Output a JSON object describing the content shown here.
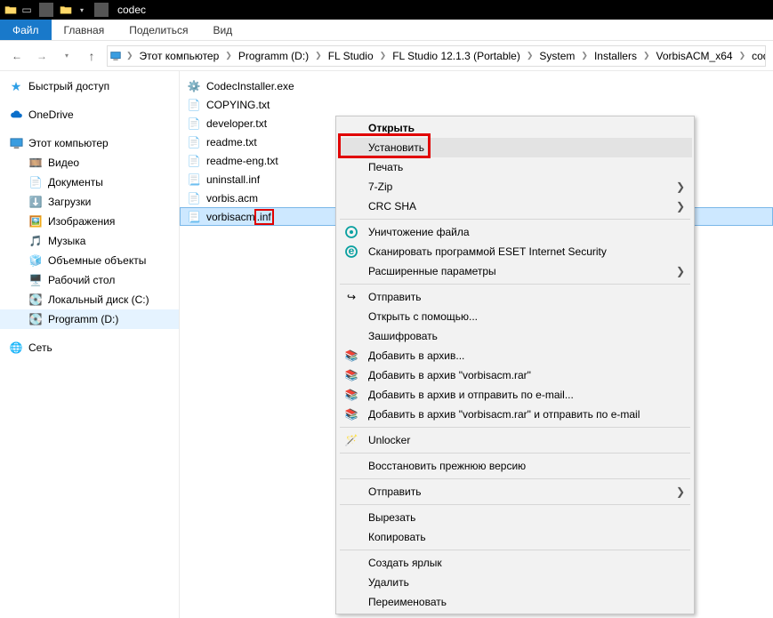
{
  "title": "codec",
  "ribbon": {
    "file": "Файл",
    "home": "Главная",
    "share": "Поделиться",
    "view": "Вид"
  },
  "breadcrumbs": [
    "Этот компьютер",
    "Programm (D:)",
    "FL Studio",
    "FL Studio 12.1.3 (Portable)",
    "System",
    "Installers",
    "VorbisACM_x64",
    "codec"
  ],
  "sidebar": {
    "quick": "Быстрый доступ",
    "onedrive": "OneDrive",
    "thispc": "Этот компьютер",
    "items": [
      "Видео",
      "Документы",
      "Загрузки",
      "Изображения",
      "Музыка",
      "Объемные объекты",
      "Рабочий стол",
      "Локальный диск (C:)",
      "Programm (D:)"
    ],
    "network": "Сеть"
  },
  "files": [
    {
      "name": "CodecInstaller.exe",
      "icon": "exe"
    },
    {
      "name": "COPYING.txt",
      "icon": "txt"
    },
    {
      "name": "developer.txt",
      "icon": "txt"
    },
    {
      "name": "readme.txt",
      "icon": "txt"
    },
    {
      "name": "readme-eng.txt",
      "icon": "txt"
    },
    {
      "name": "uninstall.inf",
      "icon": "inf"
    },
    {
      "name": "vorbis.acm",
      "icon": "acm"
    },
    {
      "name": "vorbisacm",
      "ext": ".inf",
      "icon": "inf",
      "selected": true
    }
  ],
  "context": {
    "open": "Открыть",
    "install": "Установить",
    "print": "Печать",
    "sevenzip": "7-Zip",
    "crcsha": "CRC SHA",
    "destroy": "Уничтожение файла",
    "scan": "Сканировать программой ESET Internet Security",
    "advanced": "Расширенные параметры",
    "send": "Отправить",
    "openwith": "Открыть с помощью...",
    "encrypt": "Зашифровать",
    "rar_add": "Добавить в архив...",
    "rar_named": "Добавить в архив \"vorbisacm.rar\"",
    "rar_mail": "Добавить в архив и отправить по e-mail...",
    "rar_named_mail": "Добавить в архив \"vorbisacm.rar\" и отправить по e-mail",
    "unlocker": "Unlocker",
    "restore": "Восстановить прежнюю версию",
    "sendto": "Отправить",
    "cut": "Вырезать",
    "copy": "Копировать",
    "shortcut": "Создать ярлык",
    "delete": "Удалить",
    "rename": "Переименовать"
  }
}
